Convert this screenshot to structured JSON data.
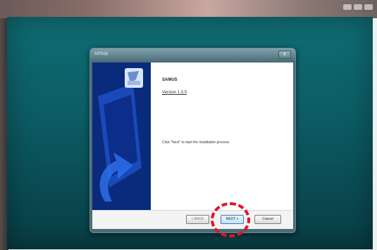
{
  "desktop": {
    "window_controls": [
      "minimize-icon",
      "restore-icon",
      "close-icon"
    ]
  },
  "installer": {
    "title": "setup",
    "close_label": "x",
    "product_name": "SAMUS",
    "version": "Version 1.3.0",
    "instruction": "Click \"Next\" to start the installation process.",
    "buttons": {
      "back": "< BACK",
      "next": "NEXT >",
      "cancel": "Cancel"
    }
  },
  "highlight": {
    "target": "next-button",
    "color": "#e2122c"
  }
}
